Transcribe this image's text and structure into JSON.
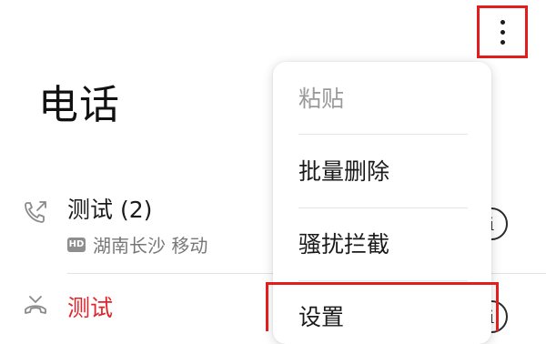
{
  "header": {
    "title": "电话"
  },
  "call_log": [
    {
      "name": "测试 (2)",
      "badge": "HD",
      "location": "湖南长沙 移动",
      "call_type": "outgoing-call-icon",
      "name_color": "#1a1a1a"
    },
    {
      "name": "测试",
      "call_type": "missed-call-icon",
      "name_color": "#e0242a"
    }
  ],
  "overflow_menu": {
    "items": [
      {
        "label": "粘贴",
        "enabled": false
      },
      {
        "label": "批量删除",
        "enabled": true
      },
      {
        "label": "骚扰拦截",
        "enabled": true
      },
      {
        "label": "设置",
        "enabled": true
      }
    ]
  },
  "icons": {
    "more": "more-vertical-icon",
    "info": "info-icon"
  },
  "colors": {
    "highlight": "#e11d1d",
    "missed": "#e0242a",
    "secondary_text": "#777777",
    "disabled_text": "#9a9a9a"
  }
}
